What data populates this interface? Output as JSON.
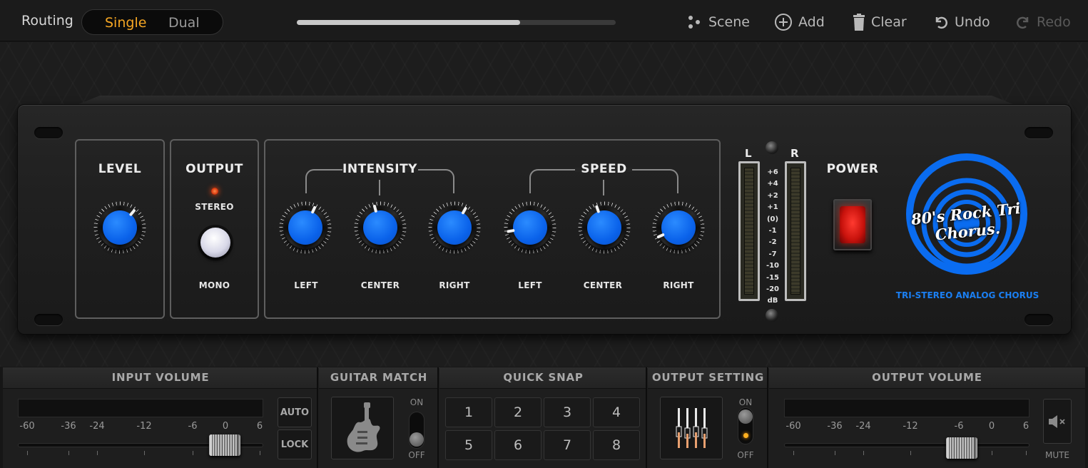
{
  "topbar": {
    "routing_label": "Routing",
    "routing_options": [
      "Single",
      "Dual"
    ],
    "routing_selected": "Single",
    "progress_fraction": 0.7,
    "scene_label": "Scene",
    "add_label": "Add",
    "clear_label": "Clear",
    "undo_label": "Undo",
    "redo_label": "Redo"
  },
  "pedal": {
    "level": {
      "title": "LEVEL"
    },
    "output": {
      "title": "OUTPUT",
      "stereo_label": "STEREO",
      "mono_label": "MONO"
    },
    "intensity": {
      "title": "INTENSITY",
      "knobs": [
        "LEFT",
        "CENTER",
        "RIGHT"
      ]
    },
    "speed": {
      "title": "SPEED",
      "knobs": [
        "LEFT",
        "CENTER",
        "RIGHT"
      ]
    },
    "meter": {
      "left_label": "L",
      "right_label": "R",
      "scale": [
        "+6",
        "+4",
        "+2",
        "+1",
        "(0)",
        "-1",
        "-2",
        "-7",
        "-10",
        "-15",
        "-20",
        "dB"
      ]
    },
    "power_label": "POWER",
    "logo_text": "80's Rock Tri Chorus.",
    "tagline": "TRI-STEREO ANALOG CHORUS",
    "accent_color": "#0a6cf0"
  },
  "bottom": {
    "input_volume": {
      "title": "INPUT VOLUME",
      "db_labels": [
        "-60",
        "-36",
        "-24",
        "-12",
        "-6",
        "0",
        "6"
      ],
      "auto_label": "AUTO",
      "lock_label": "LOCK"
    },
    "guitar_match": {
      "title": "GUITAR MATCH",
      "on_label": "ON",
      "off_label": "OFF",
      "icon": "guitar-icon"
    },
    "quick_snap": {
      "title": "QUICK SNAP",
      "slots": [
        "1",
        "2",
        "3",
        "4",
        "5",
        "6",
        "7",
        "8"
      ]
    },
    "output_setting": {
      "title": "OUTPUT SETTING",
      "on_label": "ON",
      "off_label": "OFF",
      "icon": "eq-sliders-icon"
    },
    "output_volume": {
      "title": "OUTPUT VOLUME",
      "db_labels": [
        "-60",
        "-36",
        "-24",
        "-12",
        "-6",
        "0",
        "6"
      ],
      "mute_label": "MUTE"
    }
  }
}
